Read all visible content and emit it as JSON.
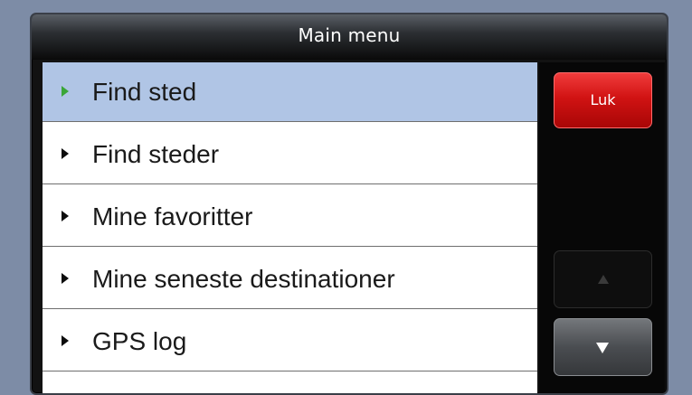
{
  "header": {
    "title": "Main menu"
  },
  "menu": {
    "items": [
      {
        "label": "Find sted",
        "icon": "triangle-right-icon",
        "selected": true
      },
      {
        "label": "Find steder",
        "icon": "triangle-right-icon",
        "selected": false
      },
      {
        "label": "Mine favoritter",
        "icon": "triangle-right-icon",
        "selected": false
      },
      {
        "label": "Mine seneste destinationer",
        "icon": "triangle-right-icon",
        "selected": false
      },
      {
        "label": "GPS log",
        "icon": "triangle-right-icon",
        "selected": false
      }
    ]
  },
  "sidebar": {
    "close_label": "Luk",
    "scroll_up_icon": "arrow-up-icon",
    "scroll_down_icon": "arrow-down-icon",
    "scroll_up_enabled": false,
    "scroll_down_enabled": true
  },
  "colors": {
    "background": "#7d8ca6",
    "selected_row": "#b0c5e5",
    "selected_arrow": "#3aa637",
    "close_button": "#d11313"
  }
}
